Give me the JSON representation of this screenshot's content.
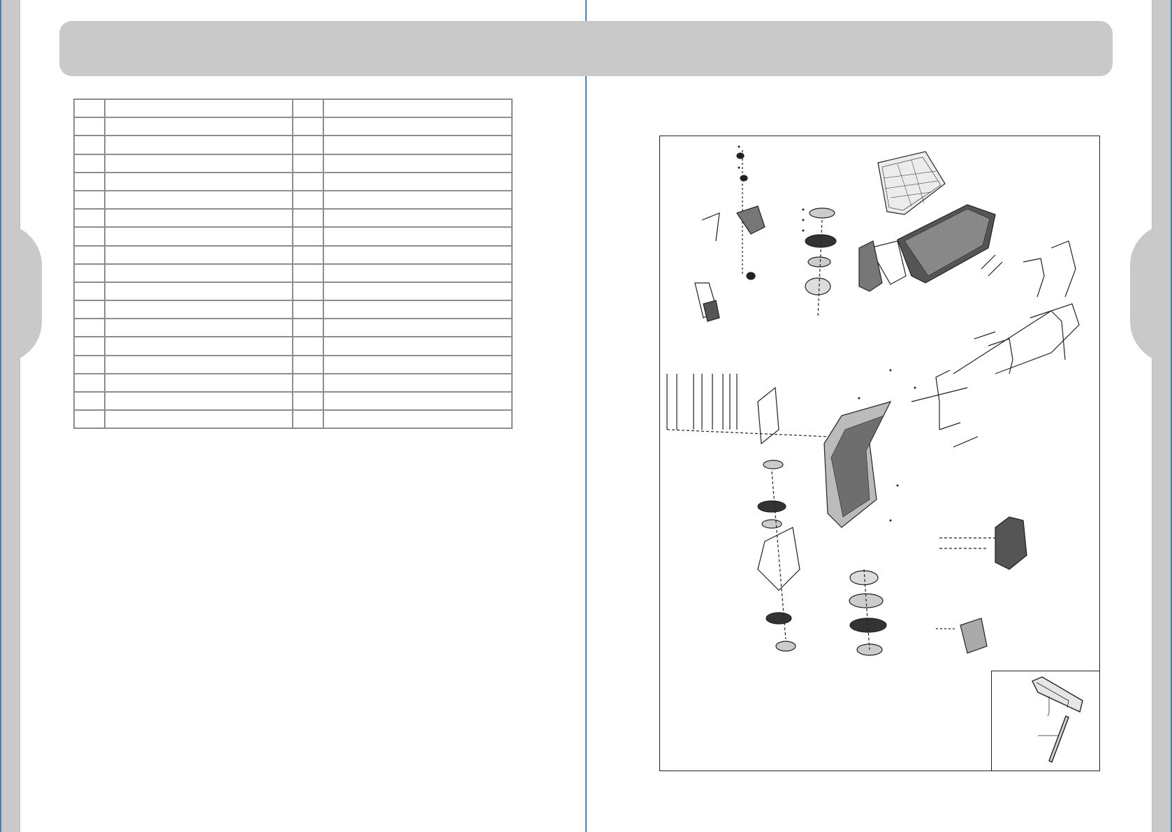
{
  "page": {
    "header_title": "",
    "table_rows": 18,
    "table_columns": [
      "",
      "",
      "",
      ""
    ]
  },
  "diagram": {
    "caption": ""
  },
  "colors": {
    "side_tab": "#c9c9c9",
    "header_band": "#c9c9c9",
    "rule_blue": "#4d7fb3",
    "table_border": "#8d8d8d",
    "line_art": "#222222"
  },
  "icons": {
    "exploded_view": "lawn-mower-exploded-view-icon",
    "inset": "tool-wrench-inset-icon"
  }
}
